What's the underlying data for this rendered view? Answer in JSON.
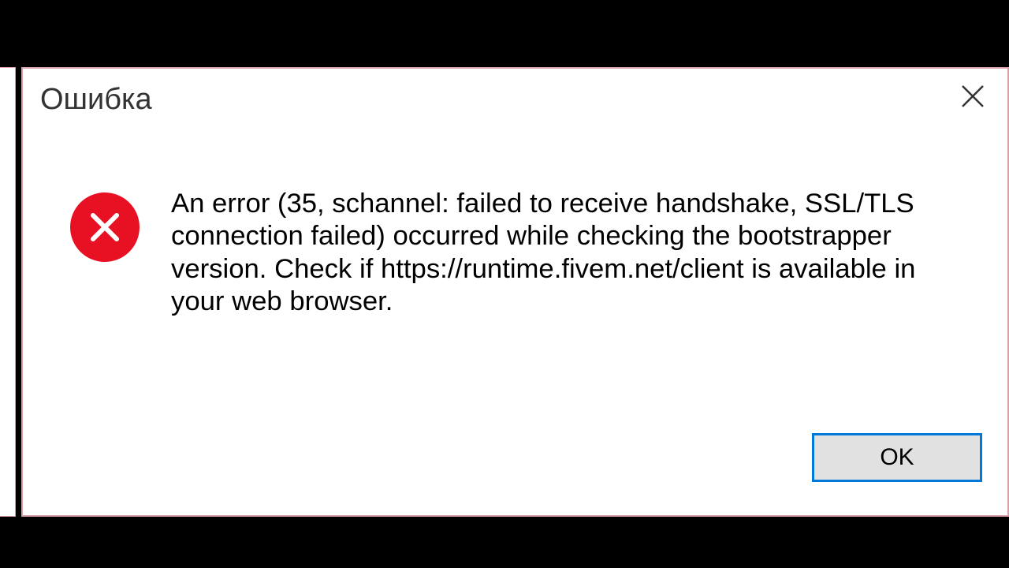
{
  "dialog": {
    "title": "Ошибка",
    "message": "An error (35, schannel: failed to receive handshake, SSL/TLS connection failed) occurred while checking the bootstrapper version. Check if https://runtime.fivem.net/client is available in your web browser.",
    "ok_button": "OK",
    "icon_name": "error-circle-x",
    "colors": {
      "error_red": "#e81123",
      "focus_blue": "#0078d7",
      "border_pink": "#d8a0a8"
    }
  }
}
